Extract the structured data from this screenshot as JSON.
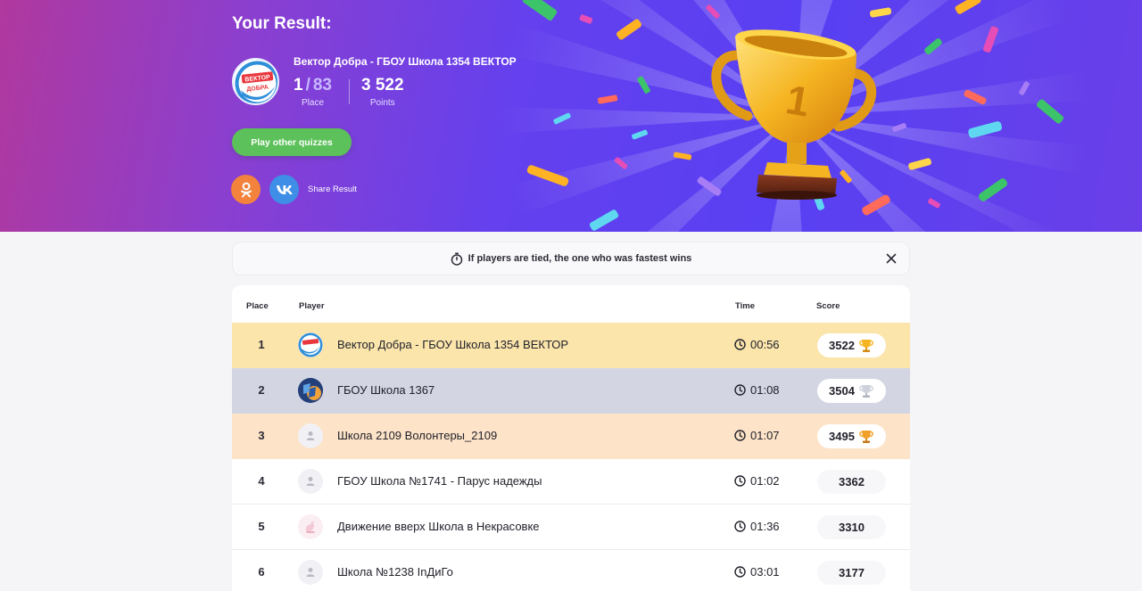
{
  "hero": {
    "title": "Your Result:",
    "team_name": "Вектор Добра - ГБОУ Школа 1354 ВЕКТОР",
    "logo_text_top": "ВЕКТОР",
    "logo_text_bottom": "ДОБРА",
    "place": "1",
    "place_sep": "/",
    "place_total": "83",
    "place_label": "Place",
    "points": "3 522",
    "points_label": "Points",
    "trophy_number": "1",
    "play_button": "Play other quizzes",
    "share_label": "Share Result",
    "social": [
      {
        "name": "odnoklassniki-icon",
        "color": "#f2823c"
      },
      {
        "name": "vk-icon",
        "color": "#3e8ee8"
      }
    ]
  },
  "notice": {
    "text": "If players are tied, the one who was fastest wins"
  },
  "table": {
    "headers": {
      "place": "Place",
      "player": "Player",
      "time": "Time",
      "score": "Score"
    },
    "rows": [
      {
        "place": "1",
        "name": "Вектор Добра - ГБОУ Школа 1354 ВЕКТОР",
        "time": "00:56",
        "score": "3522",
        "medal": "gold",
        "avatar": "vektor-logo"
      },
      {
        "place": "2",
        "name": "ГБОУ Школа 1367",
        "time": "01:08",
        "score": "3504",
        "medal": "silver",
        "avatar": "school-emblem"
      },
      {
        "place": "3",
        "name": "Школа 2109 Волонтеры_2109",
        "time": "01:07",
        "score": "3495",
        "medal": "bronze",
        "avatar": "default-user"
      },
      {
        "place": "4",
        "name": "ГБОУ Школа №1741 - Парус надежды",
        "time": "01:02",
        "score": "3362",
        "medal": "",
        "avatar": "default-user"
      },
      {
        "place": "5",
        "name": "Движение вверх Школа в Некрасовке",
        "time": "01:36",
        "score": "3310",
        "medal": "",
        "avatar": "bird-logo"
      },
      {
        "place": "6",
        "name": "Школа №1238 InДиГо",
        "time": "03:01",
        "score": "3177",
        "medal": "",
        "avatar": "default-user"
      }
    ]
  },
  "colors": {
    "gold_row": "#fbe5ab",
    "silver_row": "#d3d5e2",
    "bronze_row": "#fde3c7",
    "play_button": "#5cc15a",
    "hero_gradient_start": "#b0389e",
    "hero_gradient_end": "#5840f2"
  }
}
